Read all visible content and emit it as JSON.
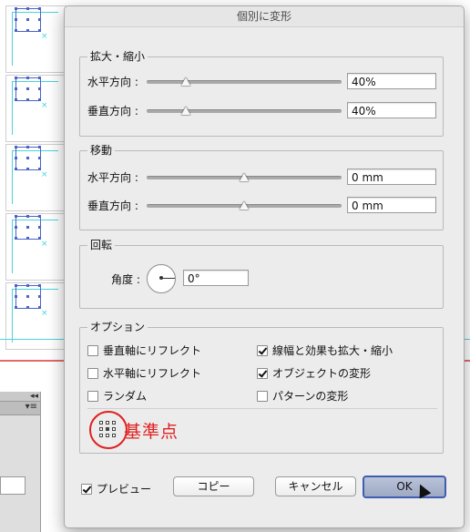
{
  "dialog": {
    "title": "個別に変形",
    "scale": {
      "legend": "拡大・縮小",
      "horizontal_label": "水平方向 :",
      "horizontal_value": "40%",
      "horizontal_slider_fraction": 0.2,
      "vertical_label": "垂直方向 :",
      "vertical_value": "40%",
      "vertical_slider_fraction": 0.2
    },
    "move": {
      "legend": "移動",
      "horizontal_label": "水平方向 :",
      "horizontal_value": "0 mm",
      "horizontal_slider_fraction": 0.5,
      "vertical_label": "垂直方向 :",
      "vertical_value": "0 mm",
      "vertical_slider_fraction": 0.5
    },
    "rotate": {
      "legend": "回転",
      "angle_label": "角度 :",
      "angle_value": "0°"
    },
    "options": {
      "legend": "オプション",
      "reflect_vertical": {
        "label": "垂直軸にリフレクト",
        "checked": false
      },
      "reflect_horizontal": {
        "label": "水平軸にリフレクト",
        "checked": false
      },
      "random": {
        "label": "ランダム",
        "checked": false
      },
      "scale_strokes": {
        "label": "線幅と効果も拡大・縮小",
        "checked": true
      },
      "transform_objects": {
        "label": "オブジェクトの変形",
        "checked": true
      },
      "transform_patterns": {
        "label": "パターンの変形",
        "checked": false
      },
      "reference_point_label": "基準点",
      "reference_point_selected": "center"
    },
    "preview": {
      "label": "プレビュー",
      "checked": true
    },
    "buttons": {
      "copy": "コピー",
      "cancel": "キャンセル",
      "ok": "OK"
    }
  },
  "background_panel": {
    "collapse_glyph": "◂◂",
    "menu_glyph": "▾≡"
  },
  "colors": {
    "annotation_red": "#e02020",
    "guide_cyan": "#4ad3e0",
    "selection_blue": "#4a63c8",
    "default_button_border": "#3f5db4"
  }
}
